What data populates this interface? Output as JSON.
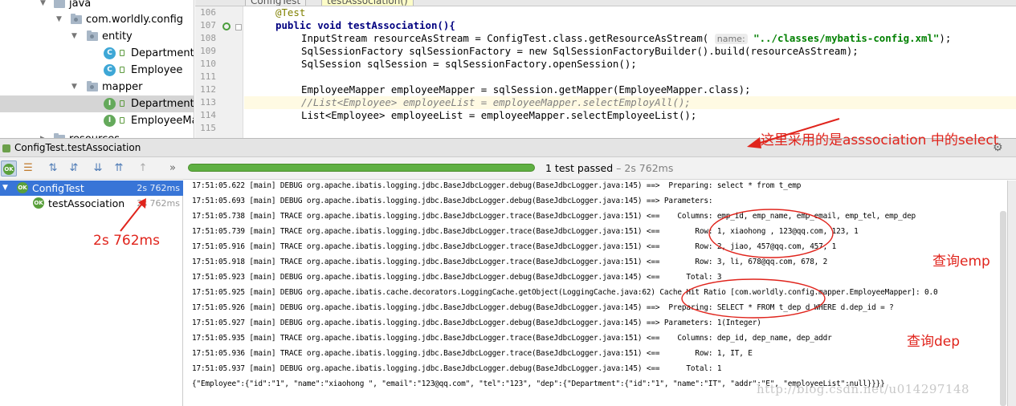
{
  "project_tree": {
    "items": [
      {
        "label": "java",
        "kind": "folder"
      },
      {
        "label": "com.worldly.config",
        "kind": "package"
      },
      {
        "label": "entity",
        "kind": "package"
      },
      {
        "label": "Department",
        "kind": "class"
      },
      {
        "label": "Employee",
        "kind": "class"
      },
      {
        "label": "mapper",
        "kind": "package"
      },
      {
        "label": "DepartmentMapper",
        "kind": "interface"
      },
      {
        "label": "EmployeeMapper",
        "kind": "interface"
      },
      {
        "label": "resources",
        "kind": "folder"
      }
    ],
    "selected": "DepartmentMapper"
  },
  "editor": {
    "tabs": [
      "ConfigTest",
      "testAssociation()"
    ],
    "lines": [
      {
        "num": "106",
        "code": "@Test"
      },
      {
        "num": "107",
        "code": "public void testAssociation(){"
      },
      {
        "num": "108",
        "code": "InputStream resourceAsStream = ConfigTest.class.getResourceAsStream(",
        "hint": "name:",
        "string": "\"../classes/mybatis-config.xml\"",
        "tail": ");"
      },
      {
        "num": "109",
        "code": "SqlSessionFactory sqlSessionFactory = new SqlSessionFactoryBuilder().build(resourceAsStream);"
      },
      {
        "num": "110",
        "code": "SqlSession sqlSession = sqlSessionFactory.openSession();"
      },
      {
        "num": "111",
        "code": ""
      },
      {
        "num": "112",
        "code": "EmployeeMapper employeeMapper = sqlSession.getMapper(EmployeeMapper.class);"
      },
      {
        "num": "113",
        "code": "//List<Employee> employeeList = employeeMapper.selectEmployAll();"
      },
      {
        "num": "114",
        "code": "List<Employee> employeeList = employeeMapper.selectEmployeeList();"
      },
      {
        "num": "115",
        "code": ""
      }
    ]
  },
  "run_window": {
    "title": "ConfigTest.testAssociation",
    "status": "1 test passed",
    "duration": "– 2s 762ms",
    "progress": 1.0
  },
  "test_tree": [
    {
      "label": "ConfigTest",
      "time": "2s 762ms",
      "selected": true
    },
    {
      "label": "testAssociation",
      "time": "2s 762ms",
      "selected": false
    }
  ],
  "console": [
    "17:51:05.622 [main] DEBUG org.apache.ibatis.logging.jdbc.BaseJdbcLogger.debug(BaseJdbcLogger.java:145) ==>  Preparing: select * from t_emp",
    "17:51:05.693 [main] DEBUG org.apache.ibatis.logging.jdbc.BaseJdbcLogger.debug(BaseJdbcLogger.java:145) ==> Parameters: ",
    "17:51:05.738 [main] TRACE org.apache.ibatis.logging.jdbc.BaseJdbcLogger.trace(BaseJdbcLogger.java:151) <==    Columns: emp_id, emp_name, emp_email, emp_tel, emp_dep",
    "17:51:05.739 [main] TRACE org.apache.ibatis.logging.jdbc.BaseJdbcLogger.trace(BaseJdbcLogger.java:151) <==        Row: 1, xiaohong , 123@qq.com, 123, 1",
    "17:51:05.916 [main] TRACE org.apache.ibatis.logging.jdbc.BaseJdbcLogger.trace(BaseJdbcLogger.java:151) <==        Row: 2, jiao, 457@qq.com, 457, 1",
    "17:51:05.918 [main] TRACE org.apache.ibatis.logging.jdbc.BaseJdbcLogger.trace(BaseJdbcLogger.java:151) <==        Row: 3, li, 678@qq.com, 678, 2",
    "17:51:05.923 [main] DEBUG org.apache.ibatis.logging.jdbc.BaseJdbcLogger.debug(BaseJdbcLogger.java:145) <==      Total: 3",
    "17:51:05.925 [main] DEBUG org.apache.ibatis.cache.decorators.LoggingCache.getObject(LoggingCache.java:62) Cache Hit Ratio [com.worldly.config.mapper.EmployeeMapper]: 0.0",
    "17:51:05.926 [main] DEBUG org.apache.ibatis.logging.jdbc.BaseJdbcLogger.debug(BaseJdbcLogger.java:145) ==>  Preparing: SELECT * FROM t_dep d WHERE d.dep_id = ?",
    "17:51:05.927 [main] DEBUG org.apache.ibatis.logging.jdbc.BaseJdbcLogger.debug(BaseJdbcLogger.java:145) ==> Parameters: 1(Integer)",
    "17:51:05.935 [main] TRACE org.apache.ibatis.logging.jdbc.BaseJdbcLogger.trace(BaseJdbcLogger.java:151) <==    Columns: dep_id, dep_name, dep_addr",
    "17:51:05.936 [main] TRACE org.apache.ibatis.logging.jdbc.BaseJdbcLogger.trace(BaseJdbcLogger.java:151) <==        Row: 1, IT, E",
    "17:51:05.937 [main] DEBUG org.apache.ibatis.logging.jdbc.BaseJdbcLogger.debug(BaseJdbcLogger.java:145) <==      Total: 1",
    "{\"Employee\":{\"id\":\"1\", \"name\":\"xiaohong \", \"email\":\"123@qq.com\", \"tel\":\"123\", \"dep\":{\"Department\":{\"id\":\"1\", \"name\":\"IT\", \"addr\":\"E\", \"employeeList\":null}}}}"
  ],
  "annotations": {
    "association_note": "这里采用的是asssociation 中的select",
    "time_note": "2s 762ms",
    "emp_note": "查询emp",
    "dep_note": "查询dep",
    "color": "#e0241c"
  },
  "watermark": "http://blog.csdn.net/u014297148",
  "colors": {
    "progress": "#5fb043",
    "selection": "#3875d7",
    "keyword": "#000080",
    "string": "#008000",
    "comment": "#808080"
  }
}
